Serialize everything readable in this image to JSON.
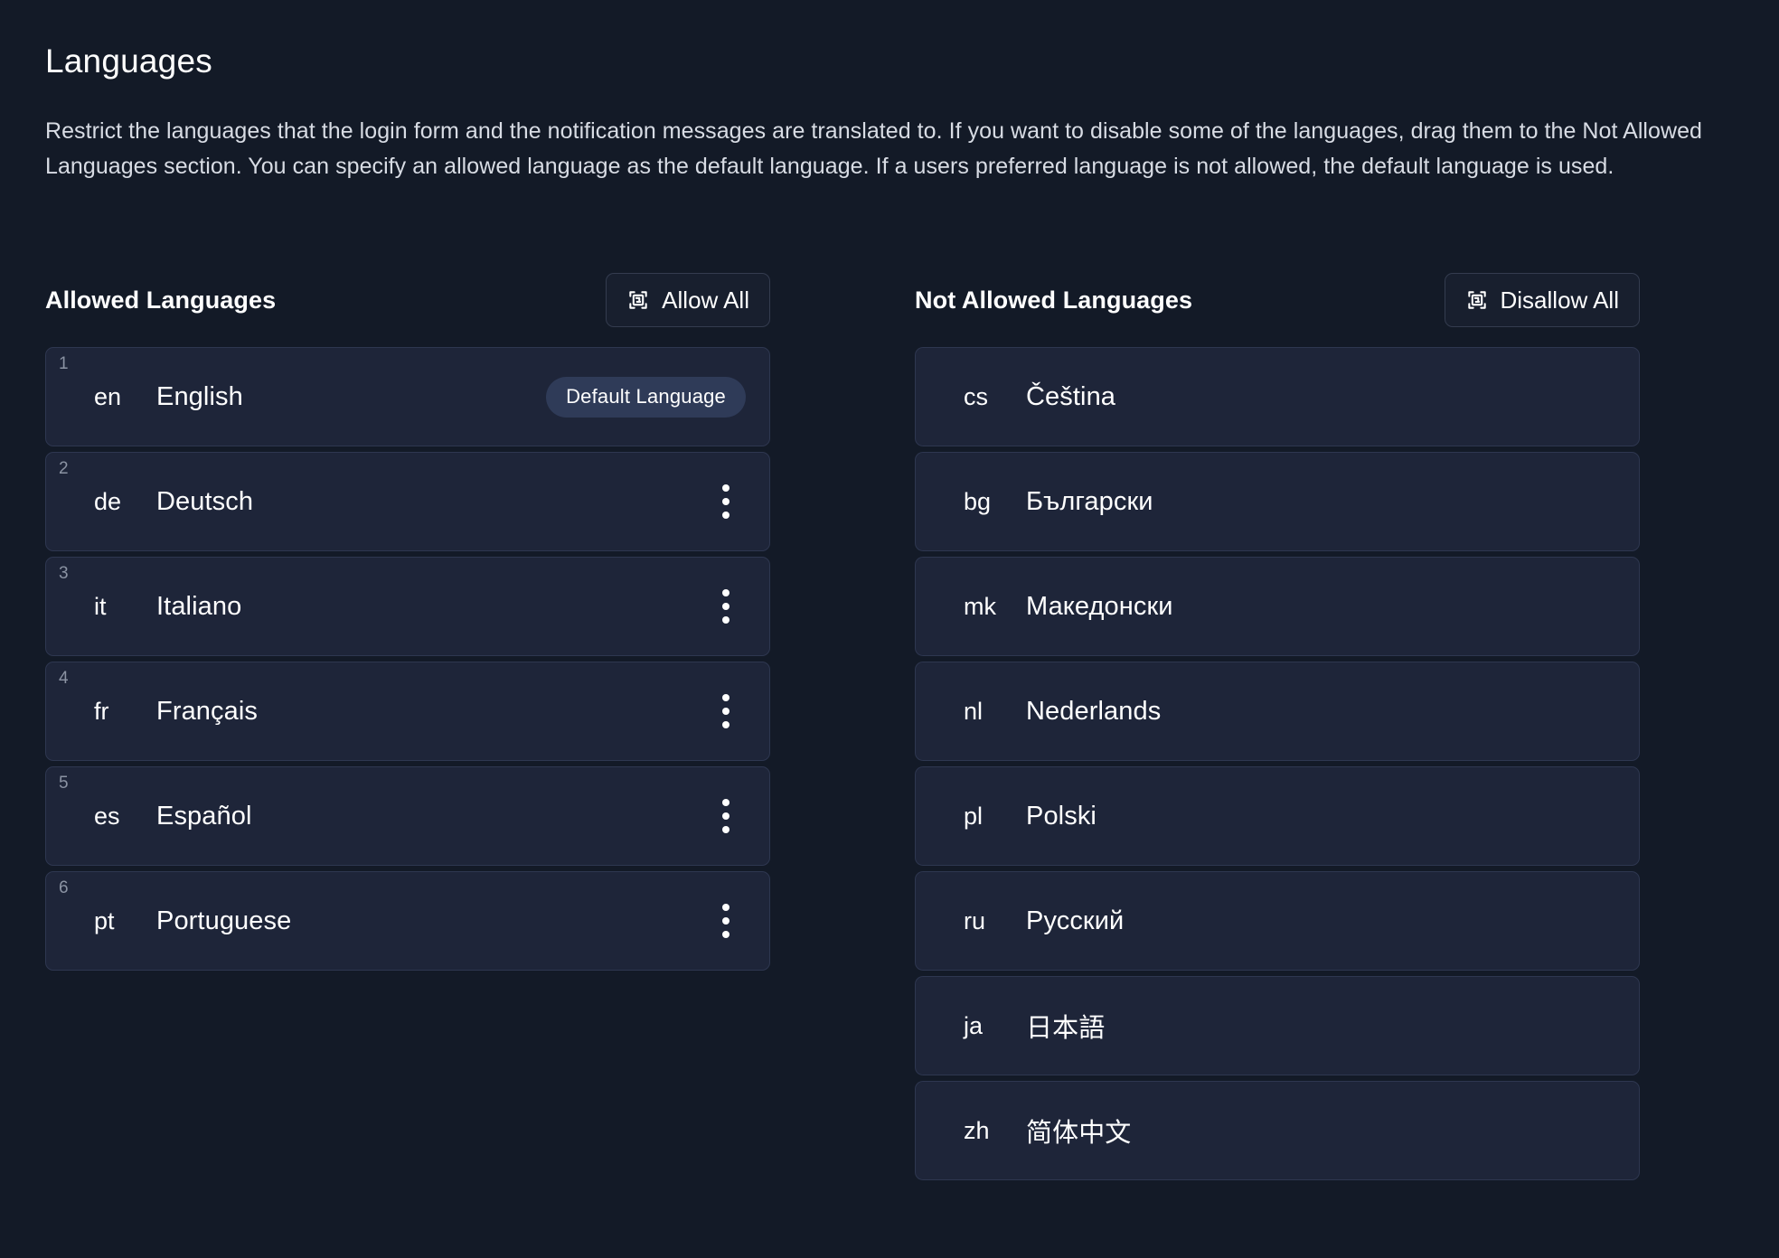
{
  "header": {
    "title": "Languages",
    "description": "Restrict the languages that the login form and the notification messages are translated to. If you want to disable some of the languages, drag them to the Not Allowed Languages section. You can specify an allowed language as the default language. If a users preferred language is not allowed, the default language is used."
  },
  "colors": {
    "page_background": "#131a27",
    "row_background": "#1e2539",
    "row_border": "#2e3750",
    "badge_background": "#2f3b58",
    "button_background": "#181f2e",
    "button_border": "#343c4f",
    "text_primary": "#ffffff",
    "text_muted": "#8b93a3",
    "text_body": "#d8dce4"
  },
  "allowed": {
    "title": "Allowed Languages",
    "action": {
      "label": "Allow All",
      "icon": "select-all-icon"
    },
    "badge_label": "Default Language",
    "menu_icon": "kebab-menu-icon",
    "items": [
      {
        "index": "1",
        "code": "en",
        "name": "English",
        "default": true
      },
      {
        "index": "2",
        "code": "de",
        "name": "Deutsch",
        "default": false
      },
      {
        "index": "3",
        "code": "it",
        "name": "Italiano",
        "default": false
      },
      {
        "index": "4",
        "code": "fr",
        "name": "Français",
        "default": false
      },
      {
        "index": "5",
        "code": "es",
        "name": "Español",
        "default": false
      },
      {
        "index": "6",
        "code": "pt",
        "name": "Portuguese",
        "default": false
      }
    ]
  },
  "not_allowed": {
    "title": "Not Allowed Languages",
    "action": {
      "label": "Disallow All",
      "icon": "select-all-icon"
    },
    "items": [
      {
        "code": "cs",
        "name": "Čeština"
      },
      {
        "code": "bg",
        "name": "Български"
      },
      {
        "code": "mk",
        "name": "Македонски"
      },
      {
        "code": "nl",
        "name": "Nederlands"
      },
      {
        "code": "pl",
        "name": "Polski"
      },
      {
        "code": "ru",
        "name": "Русский"
      },
      {
        "code": "ja",
        "name": "日本語"
      },
      {
        "code": "zh",
        "name": "简体中文"
      }
    ]
  }
}
